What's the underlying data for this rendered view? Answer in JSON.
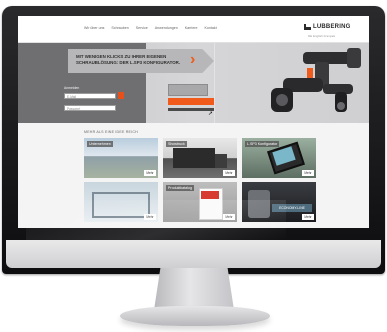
{
  "screen": {
    "nav": [
      "Wir über uns",
      "Schrauben",
      "Service",
      "Anwendungen",
      "Karriere",
      "Kontakt"
    ],
    "logo": "LUBBERING",
    "lang": "DE  English  Français",
    "hero": {
      "headline": "MIT WENIGEN KLICKS ZU IHRER EIGENEN SCHRAUBLÖSUNG: DER L.SP3 KONFIGURATOR.",
      "form_label": "Anmelden",
      "field_1": "E-Mail",
      "field_2": "Passwort"
    },
    "section_title": "MEHR ALS EINE IDEE REICH",
    "tiles": [
      {
        "label": "Unternehmen",
        "more": "Mehr"
      },
      {
        "label": "Showtruck",
        "more": "Mehr"
      },
      {
        "label": "L.SP3 Konfigurator",
        "more": "Mehr"
      },
      {
        "label": "",
        "more": "Mehr"
      },
      {
        "label": "Produktkatalog",
        "more": "Mehr"
      },
      {
        "label": "",
        "badge": "ECONOMY-LINE",
        "more": "Mehr"
      }
    ]
  },
  "colors": {
    "accent": "#f05a1a",
    "hero_gray": "#c8c8ca",
    "panel_dark": "#6f6f72",
    "monitor_bezel": "#1a1a1c"
  }
}
